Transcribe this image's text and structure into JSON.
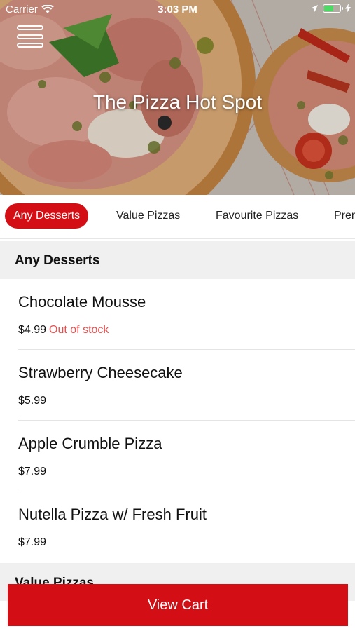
{
  "status_bar": {
    "carrier": "Carrier",
    "time": "3:03 PM",
    "wifi_icon": "wifi-icon",
    "location_icon": "location-arrow-icon",
    "battery_icon": "battery-icon",
    "charging_icon": "bolt-icon"
  },
  "header": {
    "menu_icon": "hamburger-menu-icon",
    "title": "The Pizza Hot Spot"
  },
  "tabs": [
    {
      "label": "Any Desserts",
      "active": true
    },
    {
      "label": "Value Pizzas",
      "active": false
    },
    {
      "label": "Favourite Pizzas",
      "active": false
    },
    {
      "label": "Premium Pizzas",
      "active": false
    }
  ],
  "sections": [
    {
      "title": "Any Desserts",
      "items": [
        {
          "name": "Chocolate Mousse",
          "price": "$4.99",
          "status": "Out of stock"
        },
        {
          "name": "Strawberry Cheesecake",
          "price": "$5.99",
          "status": ""
        },
        {
          "name": "Apple Crumble Pizza",
          "price": "$7.99",
          "status": ""
        },
        {
          "name": "Nutella Pizza w/ Fresh Fruit",
          "price": "$7.99",
          "status": ""
        }
      ]
    },
    {
      "title": "Value Pizzas",
      "items": []
    }
  ],
  "cart": {
    "label": "View Cart"
  },
  "colors": {
    "accent": "#d30f15",
    "out_of_stock": "#e8504f",
    "section_bg": "#f0f0f0"
  }
}
